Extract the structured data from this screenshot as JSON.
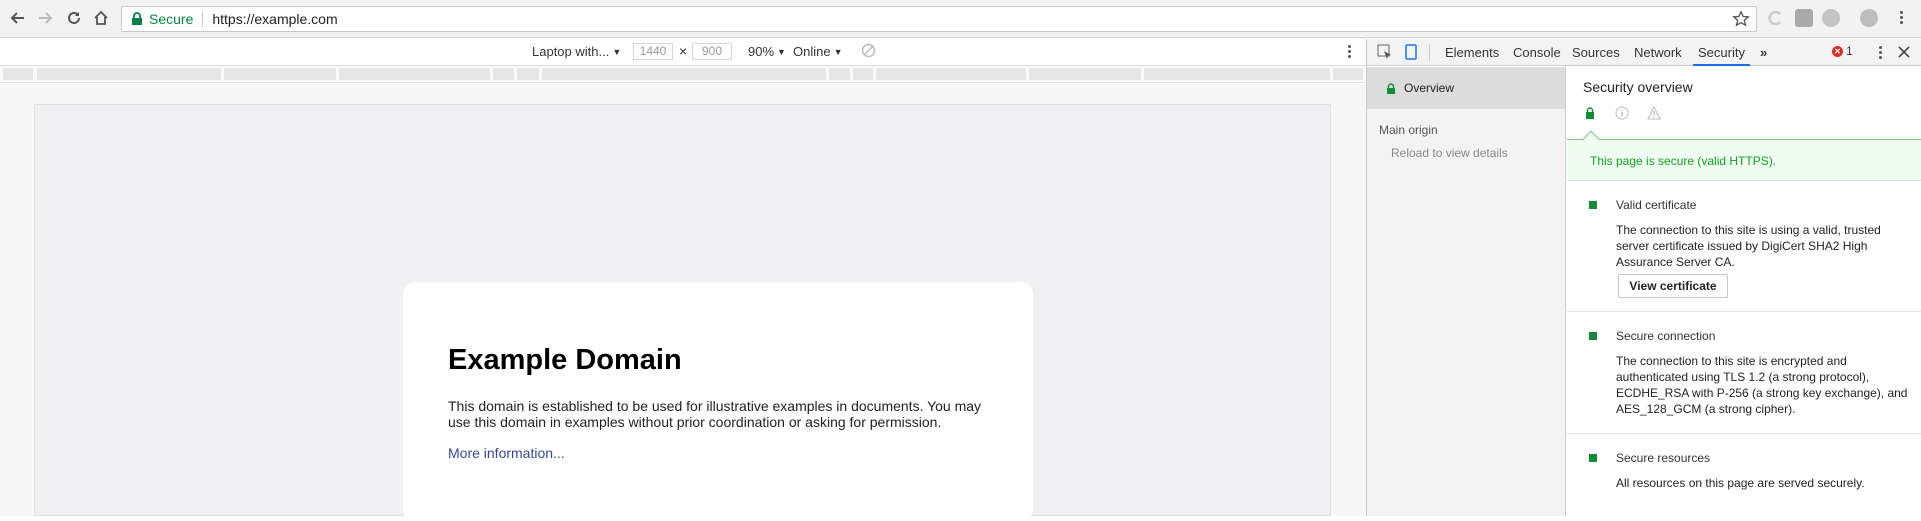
{
  "browser": {
    "secure_label": "Secure",
    "url": "https://example.com"
  },
  "device_toolbar": {
    "device": "Laptop with...",
    "width": "1440",
    "times": "×",
    "height": "900",
    "zoom": "90%",
    "network": "Online"
  },
  "page": {
    "heading": "Example Domain",
    "body": "This domain is established to be used for illustrative examples in documents. You may use this domain in examples without prior coordination or asking for permission.",
    "link": "More information..."
  },
  "devtools": {
    "tabs": [
      "Elements",
      "Console",
      "Sources",
      "Network",
      "Security"
    ],
    "more": "»",
    "error_count": "1",
    "sidebar": {
      "overview": "Overview",
      "main_origin": "Main origin",
      "reload": "Reload to view details"
    },
    "security": {
      "title": "Security overview",
      "banner": "This page is secure (valid HTTPS).",
      "items": [
        {
          "title": "Valid certificate",
          "desc": "The connection to this site is using a valid, trusted server certificate issued by DigiCert SHA2 High Assurance Server CA.",
          "button": "View certificate"
        },
        {
          "title": "Secure connection",
          "desc": "The connection to this site is encrypted and authenticated using TLS 1.2 (a strong protocol), ECDHE_RSA with P-256 (a strong key exchange), and AES_128_GCM (a strong cipher)."
        },
        {
          "title": "Secure resources",
          "desc": "All resources on this page are served securely."
        }
      ]
    }
  }
}
